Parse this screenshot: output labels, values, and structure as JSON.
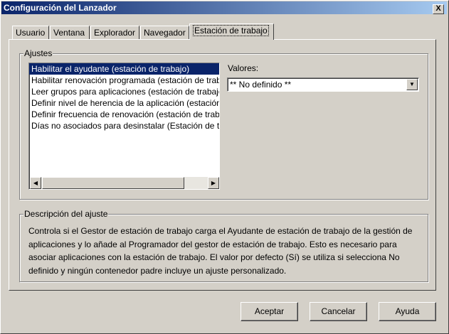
{
  "window": {
    "title": "Configuración del Lanzador",
    "close_label": "X"
  },
  "tabs": [
    "Usuario",
    "Ventana",
    "Explorador",
    "Navegador",
    "Estación de trabajo"
  ],
  "settings": {
    "group_label": "Ajustes",
    "items": [
      "Habilitar el ayudante (estación de trabajo)",
      "Habilitar renovación programada (estación de trabajo)",
      "Leer grupos para aplicaciones (estación de trabajo)",
      "Definir nivel de herencia de la aplicación (estación de trabajo)",
      "Definir frecuencia de renovación (estación de trabajo)",
      "Días no asociados para desinstalar (Estación de trabajo)"
    ],
    "selected_index": 0,
    "values_label": "Valores:",
    "values_selected": "** No definido **"
  },
  "description": {
    "group_label": "Descripción del ajuste",
    "text": "Controla si el Gestor de estación de trabajo carga el Ayudante de estación de trabajo de la gestión de aplicaciones y lo añade al Programador del gestor de estación de trabajo. Esto es necesario para asociar aplicaciones con la estación de trabajo. El valor por defecto (Sí) se utiliza si selecciona No definido y ningún contenedor padre incluye un ajuste personalizado."
  },
  "buttons": {
    "ok": "Aceptar",
    "cancel": "Cancelar",
    "help": "Ayuda"
  }
}
